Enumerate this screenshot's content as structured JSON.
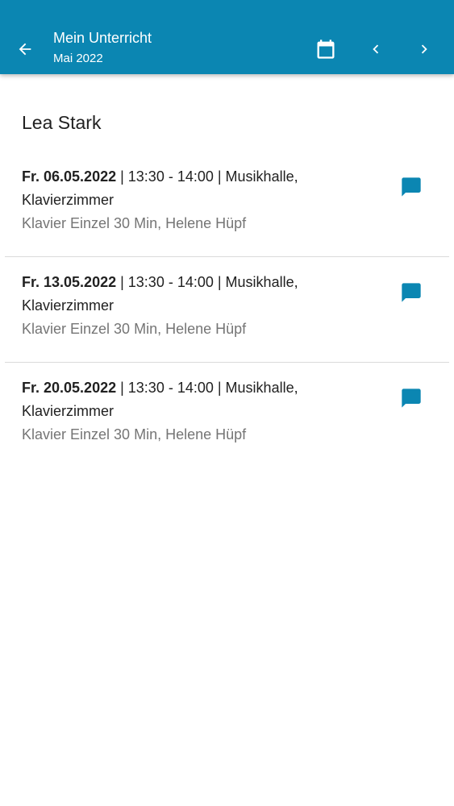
{
  "header": {
    "title": "Mein Unterricht",
    "subtitle": "Mai 2022",
    "back_icon": "arrow-left-icon",
    "calendar_icon": "calendar-icon",
    "prev_icon": "chevron-left-icon",
    "next_icon": "chevron-right-icon",
    "background_color": "#0b86b2"
  },
  "student": {
    "name": "Lea Stark"
  },
  "lessons": [
    {
      "date": "Fr. 06.05.2022",
      "details": " | 13:30 - 14:00 | Musikhalle, Klavierzimmer",
      "subtitle": "Klavier Einzel 30 Min, Helene Hüpf",
      "icon": "message-icon"
    },
    {
      "date": "Fr. 13.05.2022",
      "details": " | 13:30 - 14:00 | Musikhalle, Klavierzimmer",
      "subtitle": "Klavier Einzel 30 Min, Helene Hüpf",
      "icon": "message-icon"
    },
    {
      "date": "Fr. 20.05.2022",
      "details": " | 13:30 - 14:00 | Musikhalle, Klavierzimmer",
      "subtitle": "Klavier Einzel 30 Min, Helene Hüpf",
      "icon": "message-icon"
    }
  ],
  "colors": {
    "accent": "#0b86b2",
    "secondary_text": "#757575"
  }
}
